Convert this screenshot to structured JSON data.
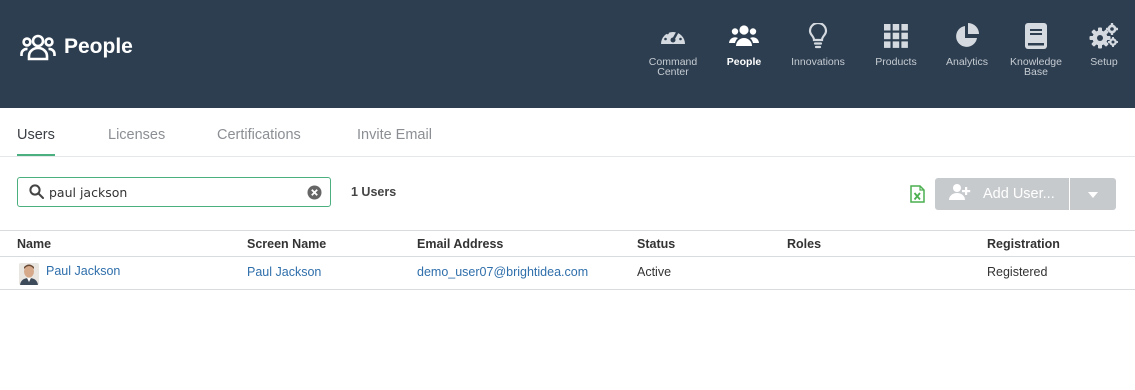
{
  "header": {
    "title": "People",
    "title_icon": "people-group-icon",
    "nav": [
      {
        "label": "Command\nCenter",
        "icon": "dashboard-gauge-icon",
        "active": false
      },
      {
        "label": "People",
        "icon": "people-group-icon",
        "active": true
      },
      {
        "label": "Innovations",
        "icon": "lightbulb-icon",
        "active": false
      },
      {
        "label": "Products",
        "icon": "grid-icon",
        "active": false
      },
      {
        "label": "Analytics",
        "icon": "pie-chart-icon",
        "active": false
      },
      {
        "label": "Knowledge\nBase",
        "icon": "book-icon",
        "active": false
      },
      {
        "label": "Setup",
        "icon": "gears-icon",
        "active": false
      }
    ]
  },
  "tabs": [
    {
      "label": "Users",
      "active": true
    },
    {
      "label": "Licenses",
      "active": false
    },
    {
      "label": "Certifications",
      "active": false
    },
    {
      "label": "Invite Email",
      "active": false
    }
  ],
  "toolbar": {
    "search_value": "paul jackson",
    "user_count": "1 Users",
    "add_user_label": "Add User...",
    "export_icon": "excel-export-icon"
  },
  "table": {
    "columns": [
      "Name",
      "Screen Name",
      "Email Address",
      "Status",
      "Roles",
      "Registration"
    ],
    "rows": [
      {
        "name": "Paul Jackson",
        "screen_name": "Paul Jackson",
        "email": "demo_user07@brightidea.com",
        "status": "Active",
        "roles": "",
        "registration": "Registered"
      }
    ]
  },
  "colors": {
    "header_bg": "#2d3e50",
    "accent": "#4caf80",
    "link": "#2f6fab",
    "button_disabled": "#c7cacd"
  }
}
